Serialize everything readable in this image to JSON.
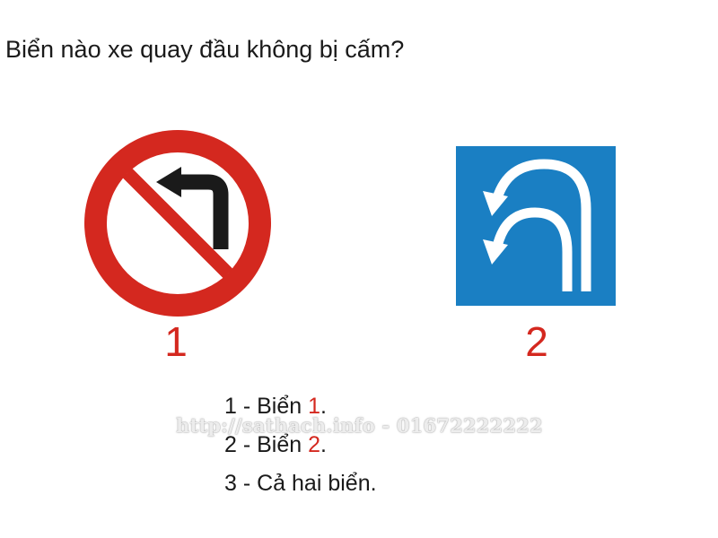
{
  "question": "Biển nào xe quay đầu không bị cấm?",
  "signs": [
    {
      "number": "1",
      "icon": "no-left-turn-sign-icon",
      "colors": {
        "ring": "#d4281f",
        "arrow": "#1a1a1a",
        "background": "#ffffff"
      }
    },
    {
      "number": "2",
      "icon": "u-turn-lanes-sign-icon",
      "colors": {
        "background": "#1a7fc3",
        "arrow": "#ffffff"
      }
    }
  ],
  "answers": [
    {
      "prefix": "1 - Biển ",
      "highlight": "1",
      "suffix": "."
    },
    {
      "prefix": "2 - Biển ",
      "highlight": "2",
      "suffix": "."
    },
    {
      "prefix": "3 - Cả hai biển.",
      "highlight": "",
      "suffix": ""
    }
  ],
  "watermark": "http://sathach.info - 01672222222",
  "colors": {
    "accent": "#d4281f",
    "text": "#1a1a1a"
  }
}
